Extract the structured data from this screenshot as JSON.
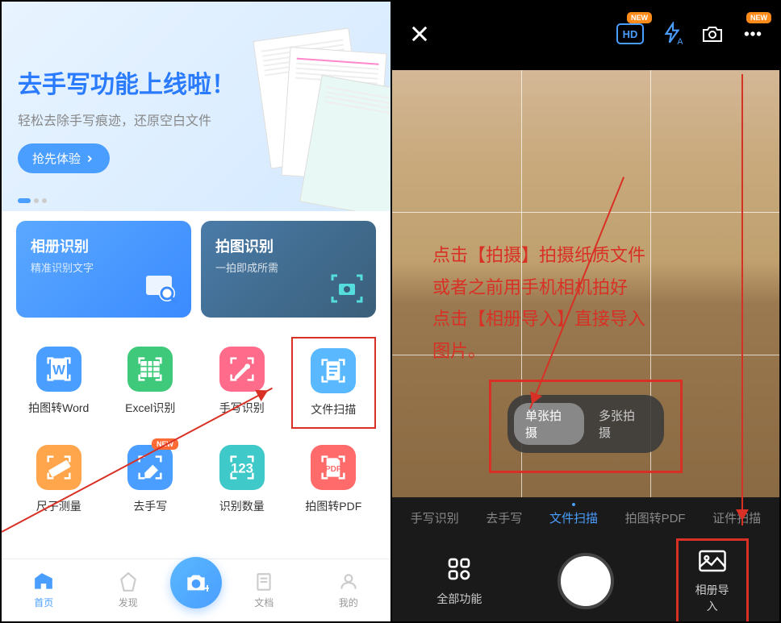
{
  "left": {
    "banner": {
      "title": "去手写功能上线啦！",
      "subtitle": "轻松去除手写痕迹，还原空白文件",
      "button": "抢先体验"
    },
    "features": {
      "album": {
        "title": "相册识别",
        "sub": "精准识别文字"
      },
      "photo": {
        "title": "拍图识别",
        "sub": "一拍即成所需"
      }
    },
    "grid": [
      {
        "label": "拍图转Word",
        "icon": "word",
        "color": "icon-blue"
      },
      {
        "label": "Excel识别",
        "icon": "excel",
        "color": "icon-green"
      },
      {
        "label": "手写识别",
        "icon": "pen",
        "color": "icon-pink"
      },
      {
        "label": "文件扫描",
        "icon": "doc",
        "color": "icon-lightblue",
        "highlight": true
      },
      {
        "label": "尺子测量",
        "icon": "ruler",
        "color": "icon-orange"
      },
      {
        "label": "去手写",
        "icon": "eraser",
        "color": "icon-blue",
        "badge": "NEW"
      },
      {
        "label": "识别数量",
        "icon": "count",
        "color": "icon-teal"
      },
      {
        "label": "拍图转PDF",
        "icon": "pdf",
        "color": "icon-red"
      }
    ],
    "nav": {
      "home": "首页",
      "discover": "发现",
      "docs": "文档",
      "mine": "我的"
    }
  },
  "right": {
    "top_badges": {
      "new": "NEW"
    },
    "overlay": "点击【拍摄】拍摄纸质文件\n或者之前用手机相机拍好\n点击【相册导入】直接导入\n图片。",
    "shoot": {
      "single": "单张拍摄",
      "multi": "多张拍摄"
    },
    "tabs": [
      "手写识别",
      "去手写",
      "文件扫描",
      "拍图转PDF",
      "证件扫描"
    ],
    "controls": {
      "all": "全部功能",
      "album": "相册导入"
    }
  }
}
